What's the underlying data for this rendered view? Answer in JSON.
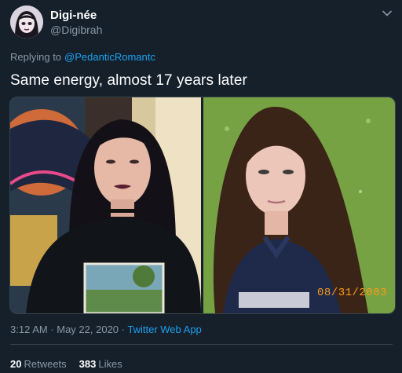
{
  "tweet": {
    "author_name": "Digi-née",
    "author_handle": "@Digibrah",
    "replying_label": "Replying to",
    "replying_to": "@PedanticRomantc",
    "text": "Same energy, almost 17 years later",
    "photo_stamp": "08/31/2003",
    "timestamp": "3:12 AM · May 22, 2020",
    "separator": " · ",
    "source_app": "Twitter Web App",
    "retweets_count": "20",
    "retweets_label": "Retweets",
    "likes_count": "383",
    "likes_label": "Likes"
  },
  "colors": {
    "background": "#15202b",
    "link": "#1da1f2",
    "secondary_text": "#8899a6",
    "divider": "#38444d",
    "date_stamp": "#ff9a1a"
  },
  "icons": [
    "chevron-down-icon"
  ]
}
